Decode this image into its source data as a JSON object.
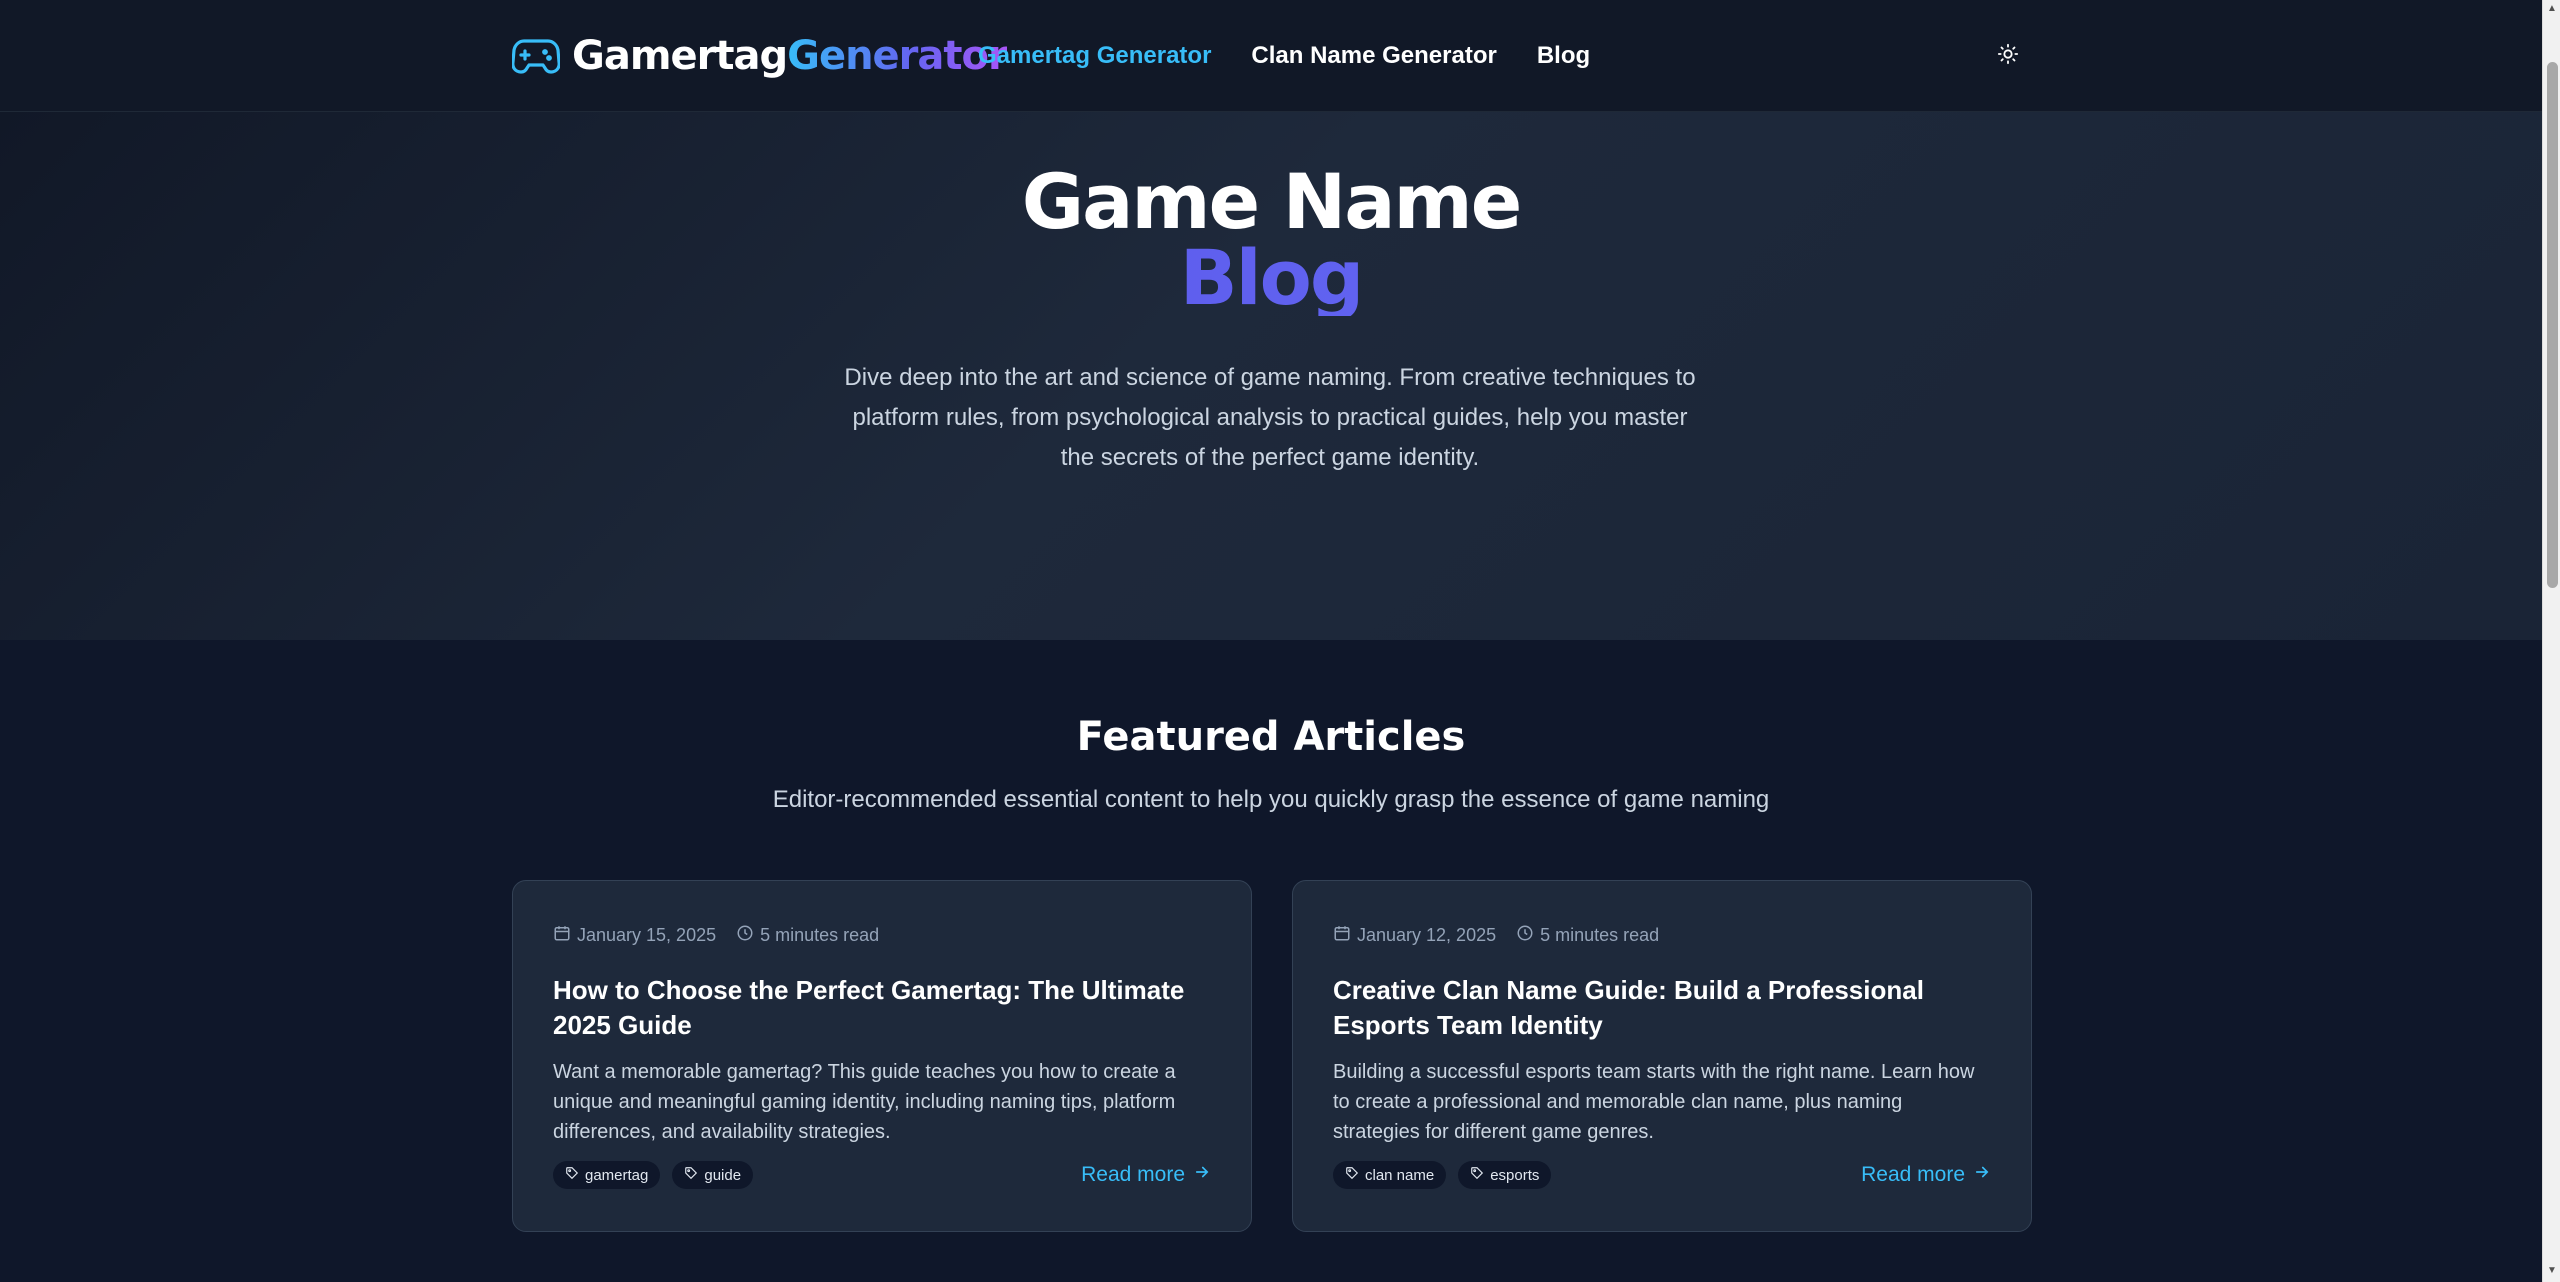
{
  "header": {
    "logo_word1": "Gamertag",
    "logo_word2": "Generator",
    "logo_icon": "gamepad-icon",
    "nav": [
      {
        "label": "Gamertag Generator",
        "active": true
      },
      {
        "label": "Clan Name Generator",
        "active": false
      },
      {
        "label": "Blog",
        "active": false
      }
    ],
    "theme_icon": "sun-icon"
  },
  "hero": {
    "title_line1": "Game Name",
    "title_line2": "Blog",
    "description": "Dive deep into the art and science of game naming. From creative techniques to platform rules, from psychological analysis to practical guides, help you master the secrets of the perfect game identity."
  },
  "featured": {
    "title": "Featured Articles",
    "subtitle": "Editor-recommended essential content to help you quickly grasp the essence of game naming",
    "articles": [
      {
        "date": "January 15, 2025",
        "read_time": "5 minutes read",
        "title": "How to Choose the Perfect Gamertag: The Ultimate 2025 Guide",
        "excerpt": "Want a memorable gamertag? This guide teaches you how to create a unique and meaningful gaming identity, including naming tips, platform differences, and availability strategies.",
        "tags": [
          "gamertag",
          "guide"
        ],
        "read_more": "Read more"
      },
      {
        "date": "January 12, 2025",
        "read_time": "5 minutes read",
        "title": "Creative Clan Name Guide: Build a Professional Esports Team Identity",
        "excerpt": "Building a successful esports team starts with the right name. Learn how to create a professional and memorable clan name, plus naming strategies for different game genres.",
        "tags": [
          "clan name",
          "esports"
        ],
        "read_more": "Read more"
      }
    ]
  },
  "colors": {
    "accent": "#38bdf8",
    "brand_indigo": "#6366f1",
    "background": "#0f172a",
    "card": "#1e293b"
  }
}
